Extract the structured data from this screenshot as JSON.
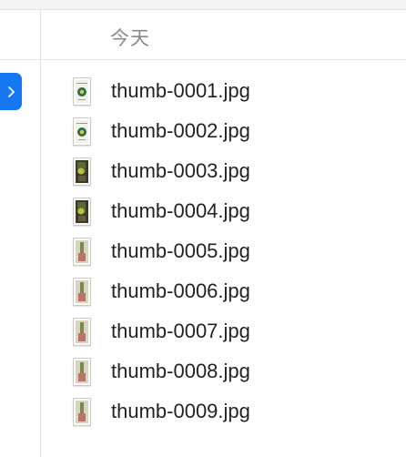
{
  "section": {
    "title": "今天"
  },
  "sidebar_toggle": {
    "icon": "chevron-right-icon",
    "color": "#1677f2"
  },
  "files": [
    {
      "name": "thumb-0001.jpg",
      "thumb": "cover"
    },
    {
      "name": "thumb-0002.jpg",
      "thumb": "cover"
    },
    {
      "name": "thumb-0003.jpg",
      "thumb": "plant-dark"
    },
    {
      "name": "thumb-0004.jpg",
      "thumb": "plant-dark"
    },
    {
      "name": "thumb-0005.jpg",
      "thumb": "plant-pot"
    },
    {
      "name": "thumb-0006.jpg",
      "thumb": "plant-pot"
    },
    {
      "name": "thumb-0007.jpg",
      "thumb": "plant-pot"
    },
    {
      "name": "thumb-0008.jpg",
      "thumb": "plant-pot"
    },
    {
      "name": "thumb-0009.jpg",
      "thumb": "plant-pot"
    }
  ]
}
